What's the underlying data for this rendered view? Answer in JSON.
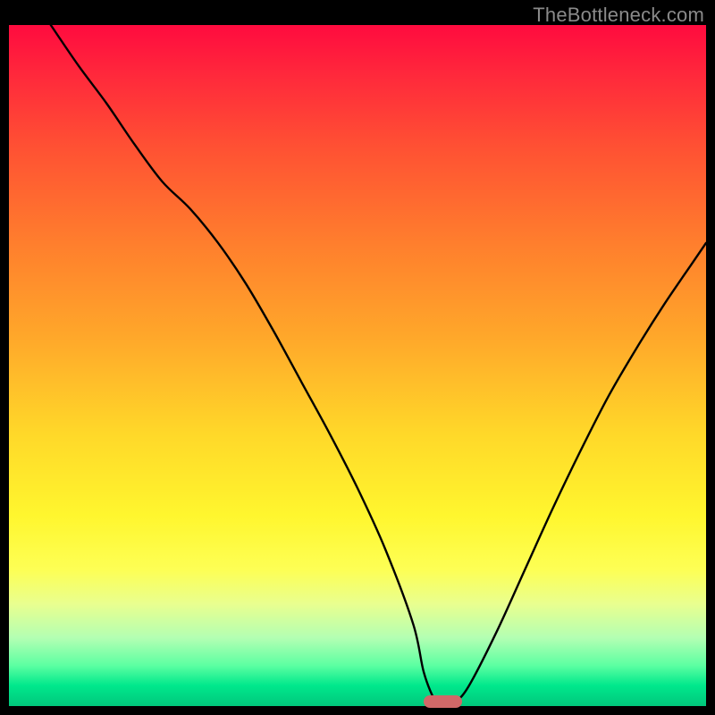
{
  "watermark": "TheBottleneck.com",
  "chart_data": {
    "type": "line",
    "title": "",
    "xlabel": "",
    "ylabel": "",
    "xlim": [
      0,
      100
    ],
    "ylim": [
      0,
      100
    ],
    "grid": false,
    "legend": false,
    "series": [
      {
        "name": "bottleneck-curve",
        "x": [
          6,
          10,
          14,
          18,
          22,
          26,
          30,
          34,
          38,
          42,
          46,
          50,
          54,
          58,
          59.5,
          61,
          62,
          63,
          64,
          66,
          70,
          74,
          78,
          82,
          86,
          90,
          94,
          98,
          100
        ],
        "y": [
          100,
          94,
          88.5,
          82.5,
          77,
          73,
          68,
          62,
          55,
          47.5,
          40,
          32,
          23,
          12,
          5,
          1,
          0,
          0,
          0.5,
          3,
          11,
          20,
          29,
          37.5,
          45.5,
          52.5,
          59,
          65,
          68
        ]
      }
    ],
    "marker": {
      "name": "optimal-range-pill",
      "x_start": 59.5,
      "x_end": 65,
      "y": 0,
      "color": "#d06868"
    }
  }
}
